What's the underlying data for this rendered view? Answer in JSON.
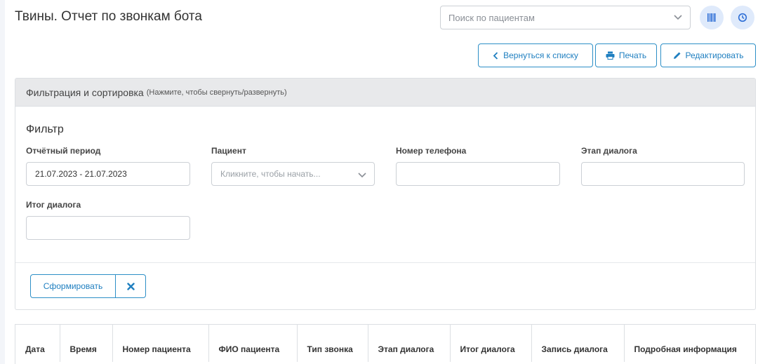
{
  "header": {
    "title": "Твины. Отчет по звонкам бота",
    "search_placeholder": "Поиск по пациентам"
  },
  "toolbar": {
    "back_label": "Вернуться к списку",
    "print_label": "Печать",
    "edit_label": "Редактировать"
  },
  "filter_panel": {
    "header_title": "Фильтрация и сортировка",
    "header_hint": "(Нажмите, чтобы свернуть/развернуть)",
    "section_title": "Фильтр",
    "fields": {
      "period_label": "Отчётный период",
      "period_value": "21.07.2023 - 21.07.2023",
      "patient_label": "Пациент",
      "patient_placeholder": "Кликните, чтобы начать...",
      "phone_label": "Номер телефона",
      "phone_value": "",
      "stage_label": "Этап диалога",
      "stage_value": "",
      "result_label": "Итог диалога",
      "result_value": ""
    },
    "submit_label": "Сформировать"
  },
  "table": {
    "columns": [
      "Дата",
      "Время",
      "Номер пациента",
      "ФИО пациента",
      "Тип звонка",
      "Этап диалога",
      "Итог диалога",
      "Запись диалога",
      "Подробная информация"
    ]
  },
  "colors": {
    "accent": "#1f7fc0",
    "accent_border": "#2d8fc7",
    "panel_header_bg": "#e8e9eb",
    "icon_button_bg": "#dfeafb"
  },
  "icons": [
    "chevron-down-icon",
    "barcode-icon",
    "clock-icon",
    "chevron-left-icon",
    "print-icon",
    "pencil-icon",
    "close-icon"
  ]
}
